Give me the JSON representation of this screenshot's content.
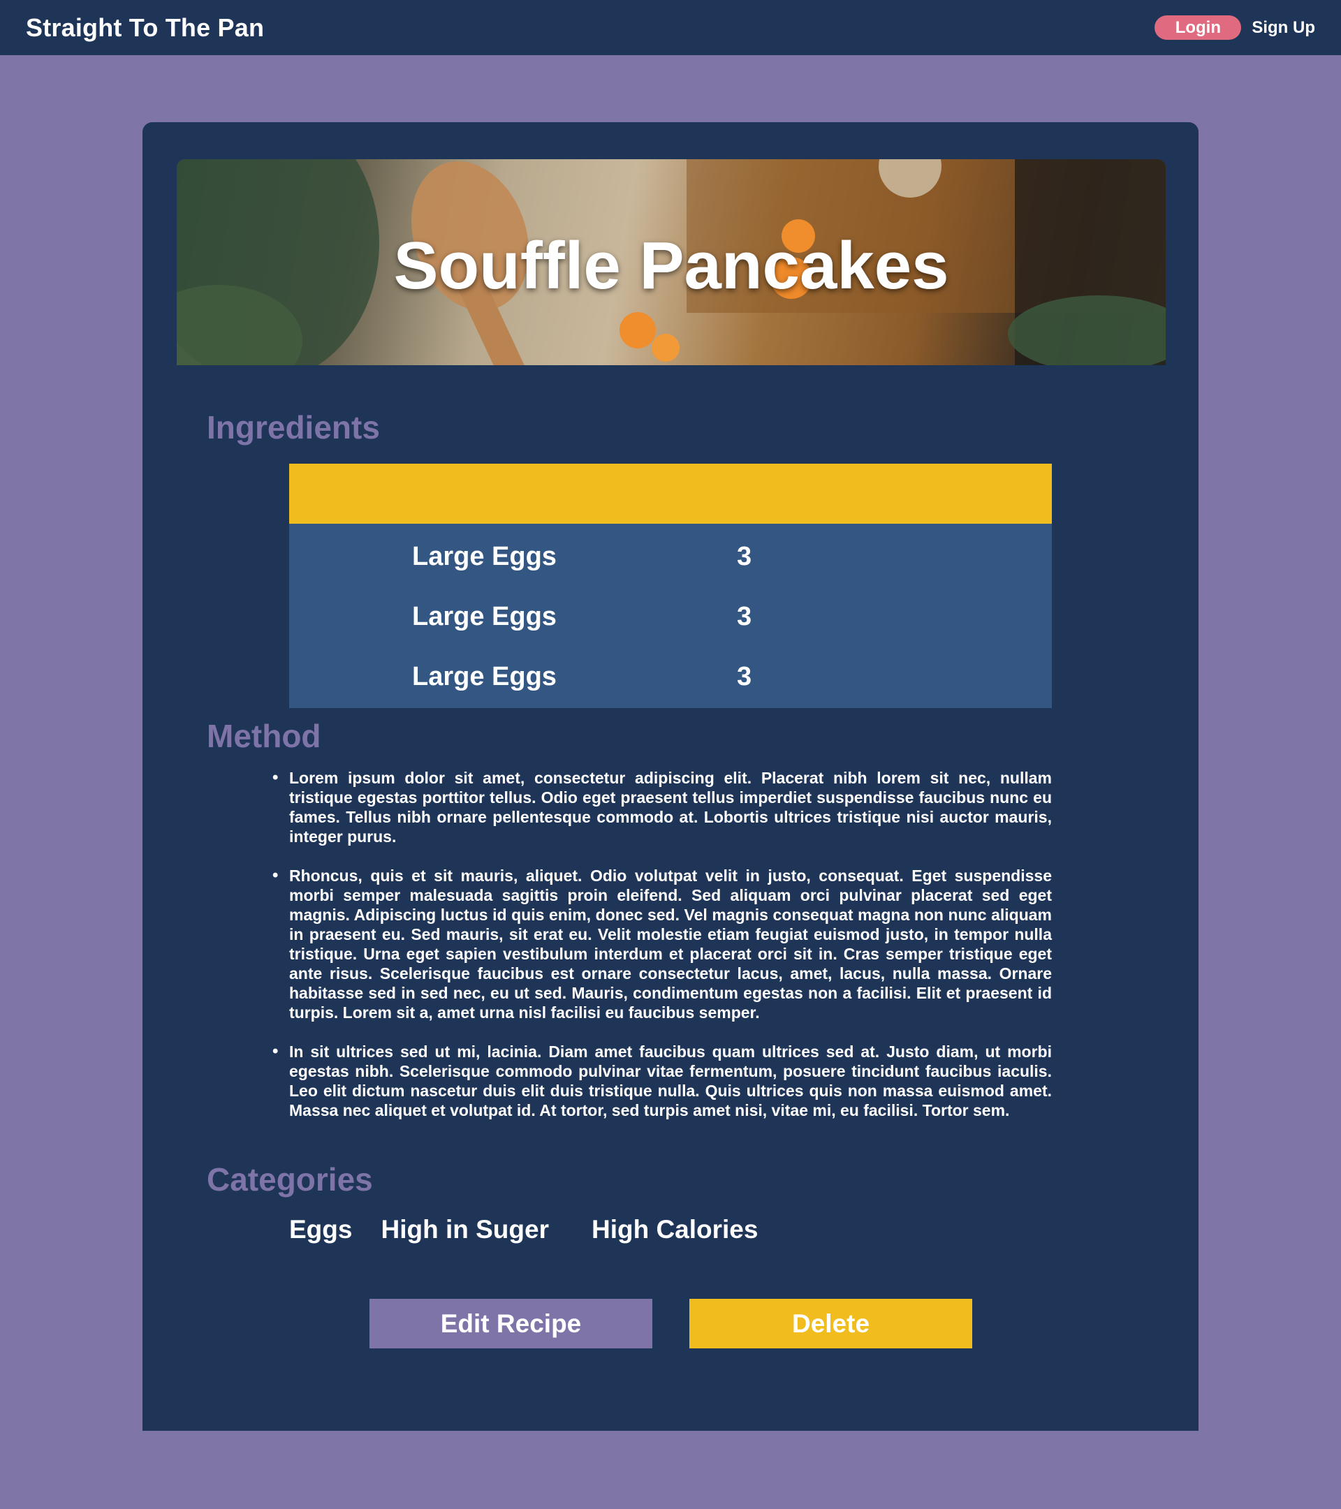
{
  "nav": {
    "brand": "Straight To The Pan",
    "login_label": "Login",
    "signup_label": "Sign Up"
  },
  "recipe": {
    "title": "Souffle Pancakes",
    "sections": {
      "ingredients": "Ingredients",
      "method": "Method",
      "categories": "Categories"
    },
    "ingredients": [
      {
        "name": "Large Eggs",
        "qty": "3"
      },
      {
        "name": "Large Eggs",
        "qty": "3"
      },
      {
        "name": "Large Eggs",
        "qty": "3"
      }
    ],
    "method": [
      "Lorem ipsum dolor sit amet, consectetur adipiscing elit. Placerat nibh lorem sit nec, nullam tristique egestas porttitor tellus. Odio eget praesent tellus imperdiet suspendisse faucibus nunc eu fames. Tellus nibh ornare pellentesque commodo at. Lobortis ultrices tristique nisi auctor mauris, integer purus.",
      "Rhoncus, quis et sit mauris, aliquet. Odio volutpat velit in justo, consequat. Eget suspendisse morbi semper malesuada sagittis proin eleifend. Sed aliquam orci pulvinar placerat sed eget magnis. Adipiscing luctus id quis enim, donec sed. Vel magnis consequat magna non nunc aliquam in praesent eu. Sed mauris, sit erat eu. Velit molestie etiam feugiat euismod justo, in tempor nulla tristique. Urna eget sapien vestibulum interdum et placerat orci sit in. Cras semper tristique eget ante risus. Scelerisque faucibus est ornare consectetur lacus, amet, lacus, nulla massa. Ornare habitasse sed in sed nec, eu ut sed. Mauris, condimentum egestas non a facilisi. Elit et praesent id turpis. Lorem sit a, amet urna nisl facilisi eu faucibus semper.",
      "In sit ultrices sed ut mi, lacinia. Diam amet faucibus quam ultrices sed at. Justo diam, ut morbi egestas nibh. Scelerisque commodo pulvinar vitae fermentum, posuere tincidunt faucibus iaculis. Leo elit dictum nascetur duis elit duis tristique nulla. Quis ultrices quis non massa euismod amet. Massa nec aliquet et volutpat id. At tortor, sed turpis amet nisi, vitae mi, eu facilisi. Tortor sem."
    ],
    "categories": [
      "Eggs",
      "High in Suger",
      "High Calories"
    ]
  },
  "actions": {
    "edit_label": "Edit Recipe",
    "delete_label": "Delete"
  },
  "colors": {
    "navbar": "#1e3557",
    "page_bg": "#7f75a7",
    "accent_yellow": "#f1bd1e",
    "accent_purple": "#7e74a8",
    "login_pink": "#e06a80",
    "table_body": "#335683"
  }
}
